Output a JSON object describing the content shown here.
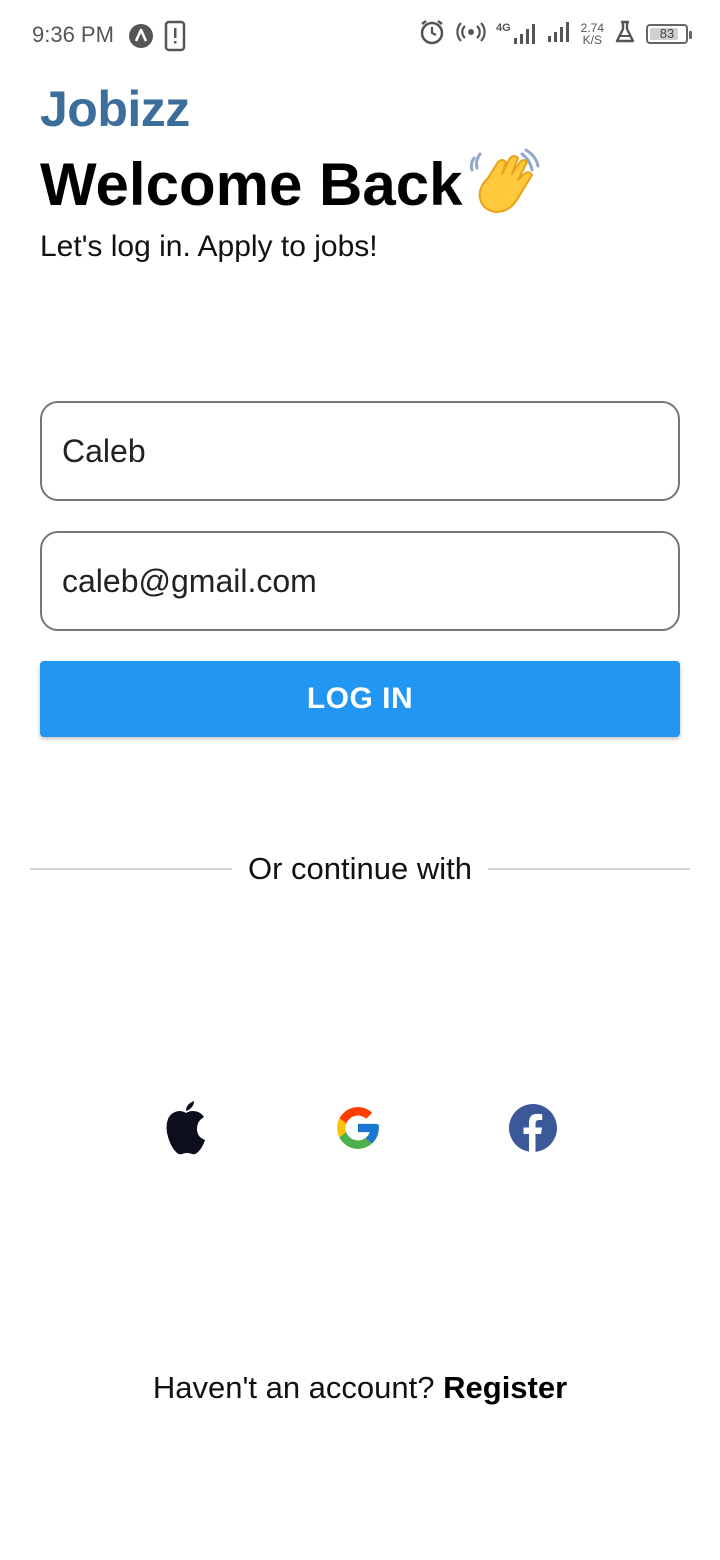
{
  "status_bar": {
    "time": "9:36 PM",
    "net_speed_value": "2.74",
    "net_speed_unit": "K/S",
    "network_type": "4G",
    "battery_level": "83",
    "battery_fraction": 0.83,
    "left_icons": [
      "app-a-icon",
      "alert-phone-icon"
    ],
    "right_icons": [
      "alarm-icon",
      "hotspot-icon",
      "signal-4g-icon",
      "signal-icon",
      "flask-icon",
      "battery-icon"
    ]
  },
  "header": {
    "brand": "Jobizz",
    "title": "Welcome Back",
    "title_emoji": "waving-hand-icon",
    "subtitle": "Let's log in. Apply to jobs!"
  },
  "form": {
    "name_value": "Caleb",
    "email_value": "caleb@gmail.com",
    "login_label": "LOG IN"
  },
  "divider": {
    "text": "Or continue with"
  },
  "social": [
    "apple-icon",
    "google-icon",
    "facebook-icon"
  ],
  "footer": {
    "prompt": "Haven't an account?",
    "register_label": "Register"
  },
  "colors": {
    "brand": "#3b6e9b",
    "primary": "#2196f3",
    "facebook": "#3b5998"
  }
}
